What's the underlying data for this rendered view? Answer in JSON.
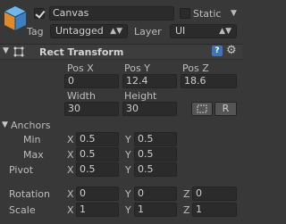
{
  "gameobject": {
    "active_checked": true,
    "name": "Canvas",
    "static_label": "Static",
    "static_checked": false,
    "tag_label": "Tag",
    "tag_value": "Untagged",
    "layer_label": "Layer",
    "layer_value": "UI"
  },
  "rect_transform": {
    "title": "Rect Transform",
    "headers": {
      "pos_x": "Pos X",
      "pos_y": "Pos Y",
      "pos_z": "Pos Z"
    },
    "values": {
      "pos_x": "0",
      "pos_y": "12.4",
      "pos_z": "18.6"
    },
    "width_label": "Width",
    "height_label": "Height",
    "width_value": "30",
    "height_value": "30",
    "raw_button_label": "R",
    "anchors_label": "Anchors",
    "min_label": "Min",
    "max_label": "Max",
    "pivot_label": "Pivot",
    "x_label": "X",
    "y_label": "Y",
    "z_label": "Z",
    "anchor_min": {
      "x": "0.5",
      "y": "0.5"
    },
    "anchor_max": {
      "x": "0.5",
      "y": "0.5"
    },
    "pivot": {
      "x": "0.5",
      "y": "0.5"
    },
    "rotation_label": "Rotation",
    "rotation": {
      "x": "0",
      "y": "0",
      "z": "0"
    },
    "scale_label": "Scale",
    "scale": {
      "x": "1",
      "y": "1",
      "z": "1"
    }
  },
  "colors": {
    "background": "#383838",
    "field": "#2b2b2b",
    "text": "#c8c8c8",
    "cube_accent": "#4a9bd9"
  },
  "icons": {
    "gameobject": "cube-icon",
    "foldout": "foldout-arrow-icon",
    "component": "rect-transform-icon",
    "help": "help-icon",
    "settings": "gear-icon",
    "blueprint": "blueprint-icon"
  }
}
